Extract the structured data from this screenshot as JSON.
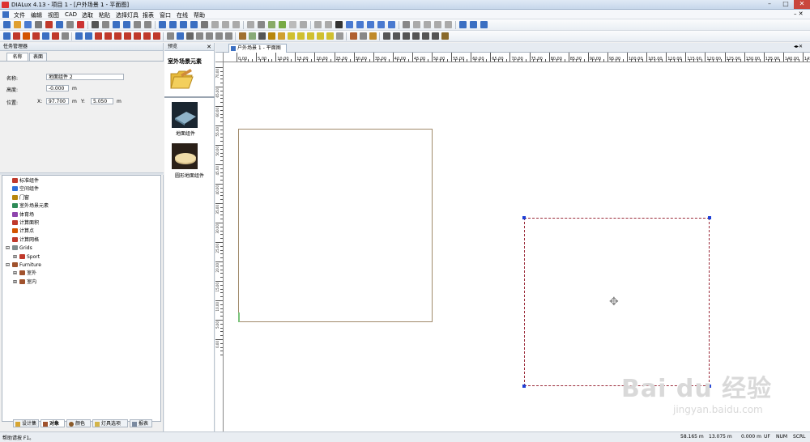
{
  "window": {
    "title": "DIALux 4.13 - 项目 1 - [户外场景 1 - 平面图]"
  },
  "menu": [
    "文件",
    "编辑",
    "视图",
    "CAD",
    "选取",
    "粘贴",
    "选择灯具",
    "报表",
    "窗口",
    "在线",
    "帮助"
  ],
  "task_manager": {
    "title": "任务管理器",
    "tabs": [
      "名称",
      "表面"
    ],
    "name_label": "名称:",
    "name_value": "地面组件 2",
    "height_label": "高度:",
    "height_value": "-0.000",
    "height_unit": "m",
    "pos_label": "位置:",
    "x_label": "X:",
    "x_value": "97.700",
    "x_unit": "m",
    "y_label": "Y:",
    "y_value": "5.050",
    "y_unit": "m"
  },
  "tree": [
    {
      "label": "标准组件",
      "indent": 0,
      "color": "#c0392b"
    },
    {
      "label": "空间组件",
      "indent": 0,
      "color": "#2e6fd8"
    },
    {
      "label": "门窗",
      "indent": 0,
      "color": "#b8860b"
    },
    {
      "label": "室外场景元素",
      "indent": 0,
      "color": "#2e8b57"
    },
    {
      "label": "体育场",
      "indent": 0,
      "color": "#8e44ad"
    },
    {
      "label": "计算面积",
      "indent": 0,
      "color": "#c0392b"
    },
    {
      "label": "计算点",
      "indent": 0,
      "color": "#d35400"
    },
    {
      "label": "计算网格",
      "indent": 0,
      "color": "#c0392b"
    },
    {
      "label": "Grids",
      "indent": 0,
      "color": "#7f8c8d",
      "expander": "⊟"
    },
    {
      "label": "Sport",
      "indent": 1,
      "color": "#c0392b",
      "expander": "⊞"
    },
    {
      "label": "Furniture",
      "indent": 0,
      "color": "#a0522d",
      "expander": "⊟"
    },
    {
      "label": "室外",
      "indent": 1,
      "color": "#a0522d",
      "expander": "⊞"
    },
    {
      "label": "室内",
      "indent": 1,
      "color": "#a0522d",
      "expander": "⊞"
    }
  ],
  "bottom_tabs": [
    "设计集",
    "对象",
    "颜色",
    "灯具选项",
    "报表"
  ],
  "preview": {
    "title": "预览",
    "heading": "室外场景元素",
    "items": [
      "地面组件",
      "圆形地面组件"
    ]
  },
  "document_tab": {
    "label": "户外场景 1 - 平面图"
  },
  "ruler_h_labels": [
    "0.00",
    "5.00",
    "10.00",
    "15.00",
    "20.00",
    "25.00",
    "30.00",
    "35.00",
    "40.00",
    "45.00",
    "50.00",
    "55.00",
    "60.00",
    "65.00",
    "70.00",
    "75.00",
    "80.00",
    "85.00",
    "90.00",
    "95.00",
    "100.00",
    "105.00",
    "110.00",
    "115.00",
    "120.00",
    "125.00",
    "130.00",
    "135.00",
    "140.00",
    "145."
  ],
  "ruler_v_labels": [
    "70.00",
    "65.00",
    "60.00",
    "55.00",
    "50.00",
    "45.00",
    "40.00",
    "35.00",
    "30.00",
    "25.00",
    "20.00",
    "15.00",
    "10.00",
    "5.00",
    "0.00"
  ],
  "status": {
    "help": "帮助请按 F1。",
    "x": "58.165 m",
    "y": "13.075 m",
    "z": "0.000 m",
    "flags": [
      "UF",
      "NUM",
      "SCRL"
    ]
  },
  "watermark": {
    "brand": "Bai du 经验",
    "url": "jingyan.baidu.com"
  },
  "colors": {
    "selection": "#1d3fd6",
    "room_outline": "#a08a6a"
  }
}
